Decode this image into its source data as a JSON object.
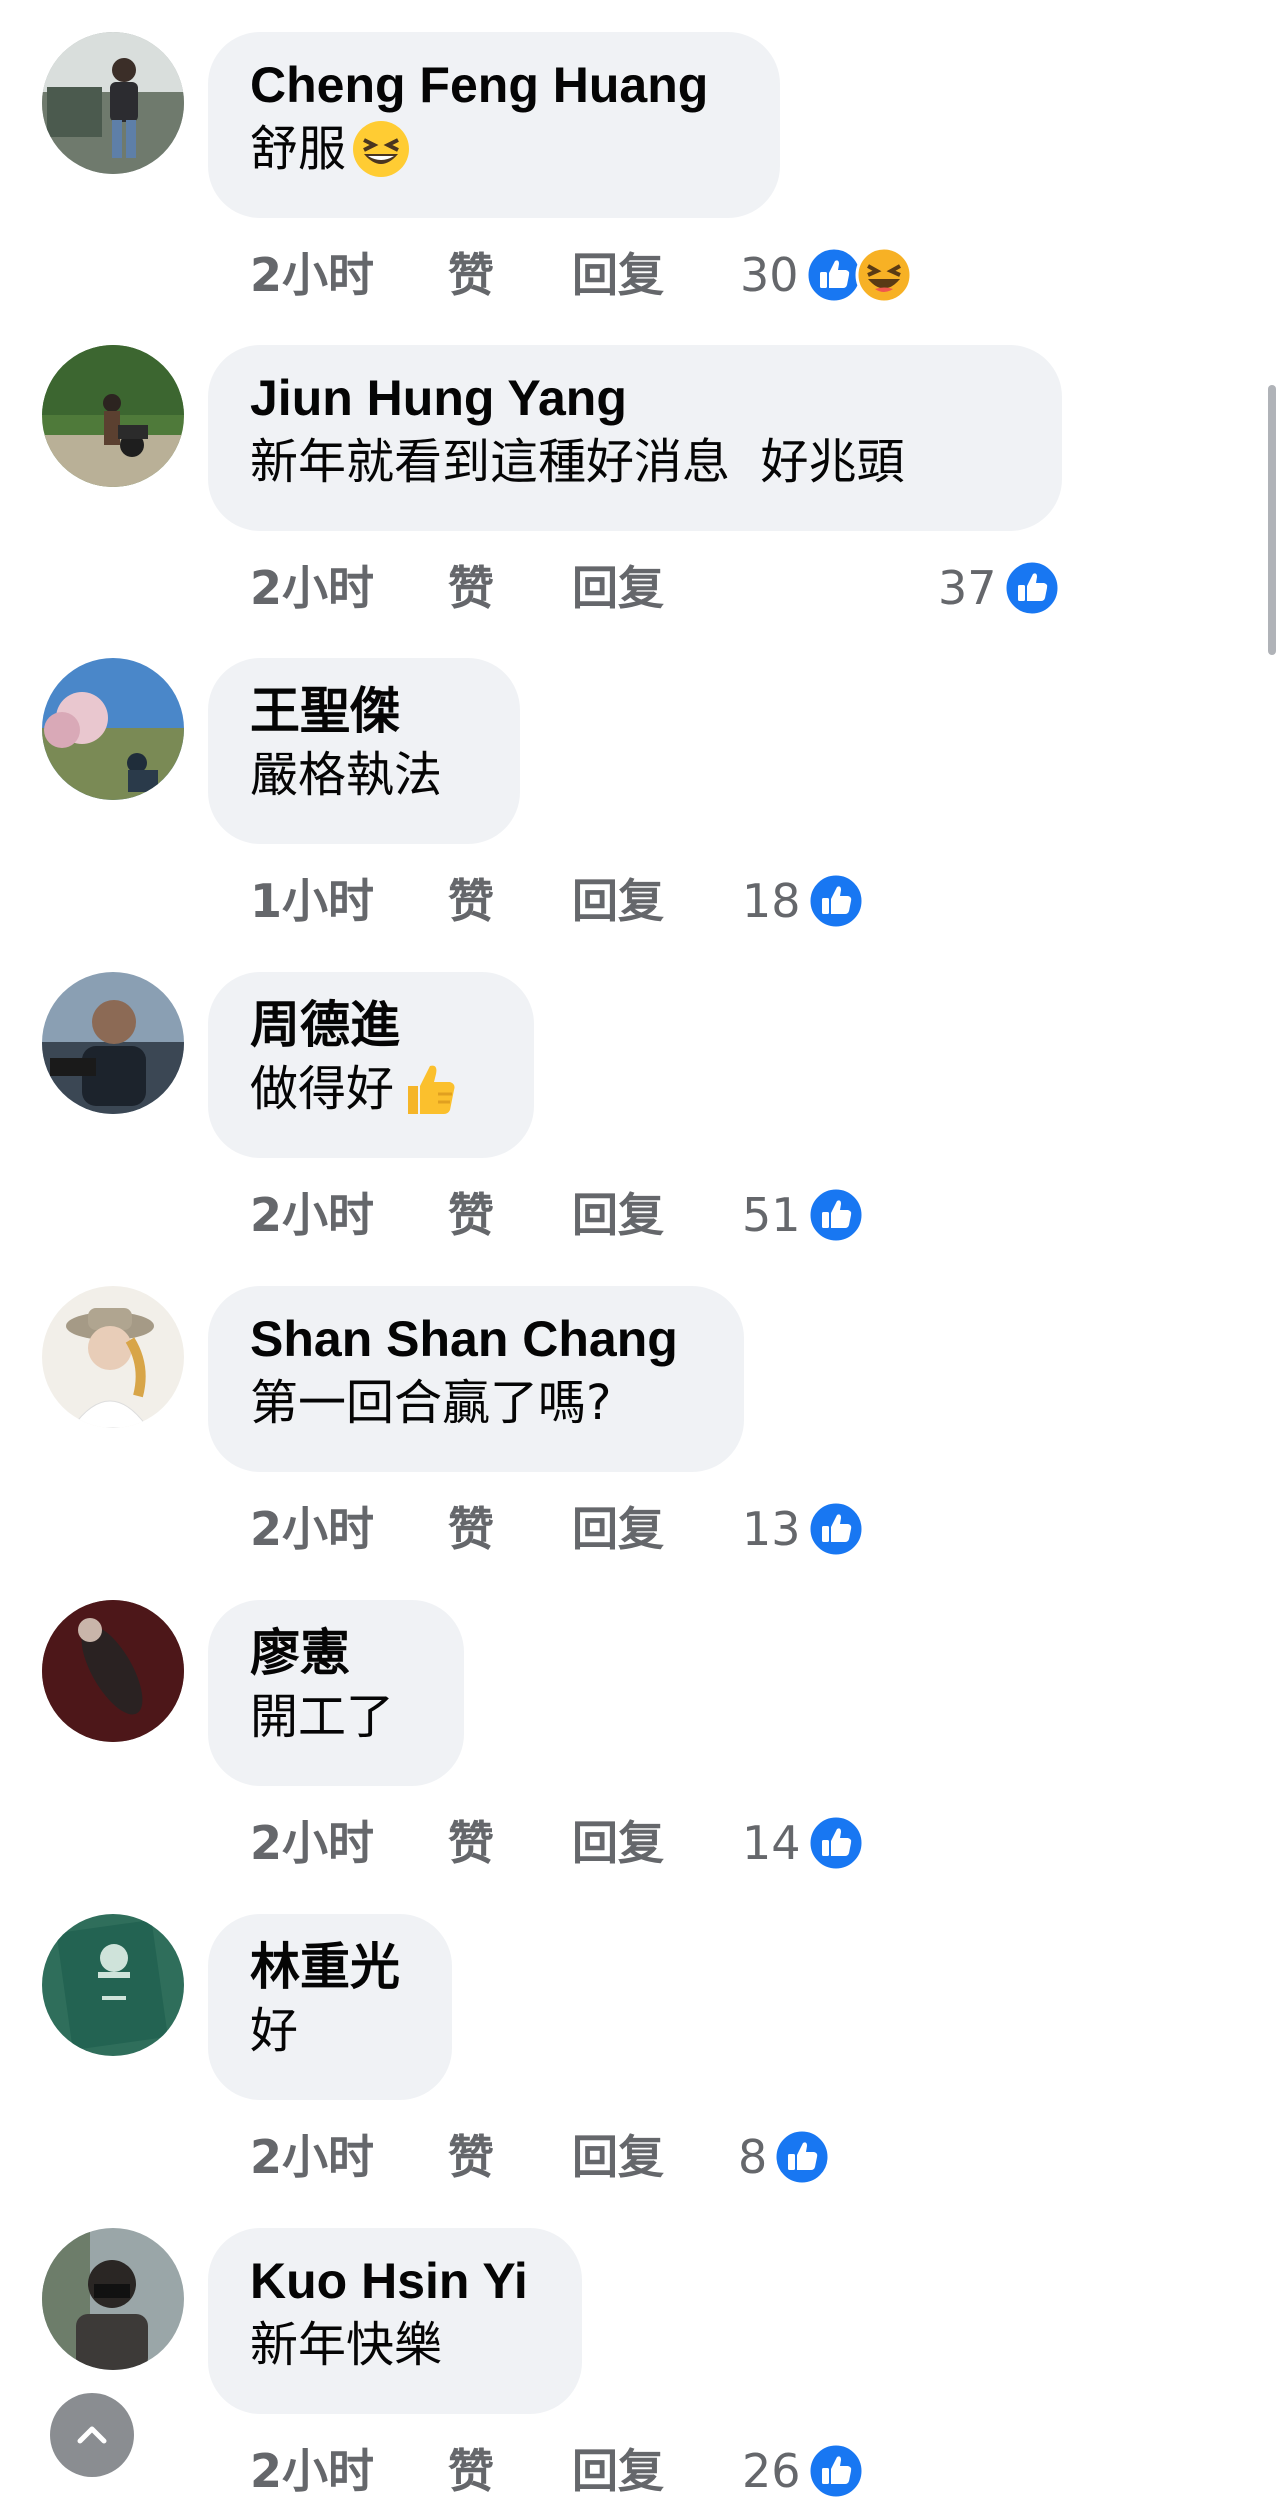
{
  "comments": [
    {
      "name": "Cheng Feng Huang",
      "text": "舒服",
      "emoji": "grinning-squinting-face",
      "time": "2小时",
      "like": "赞",
      "reply": "回复",
      "count": "30",
      "reactions": [
        "like",
        "haha"
      ]
    },
    {
      "name": "Jiun Hung Yang",
      "text": "新年就看到這種好消息  好兆頭",
      "emoji": "",
      "time": "2小时",
      "like": "赞",
      "reply": "回复",
      "count": "37",
      "reactions": [
        "like"
      ]
    },
    {
      "name": "王聖傑",
      "text": "嚴格執法",
      "emoji": "",
      "time": "1小时",
      "like": "赞",
      "reply": "回复",
      "count": "18",
      "reactions": [
        "like"
      ]
    },
    {
      "name": "周德進",
      "text": "做得好",
      "emoji": "thumbs-up",
      "time": "2小时",
      "like": "赞",
      "reply": "回复",
      "count": "51",
      "reactions": [
        "like"
      ]
    },
    {
      "name": "Shan Shan Chang",
      "text": "第一回合贏了嗎?",
      "emoji": "",
      "time": "2小时",
      "like": "赞",
      "reply": "回复",
      "count": "13",
      "reactions": [
        "like"
      ]
    },
    {
      "name": "廖憲",
      "text": "開工了",
      "emoji": "",
      "time": "2小时",
      "like": "赞",
      "reply": "回复",
      "count": "14",
      "reactions": [
        "like"
      ]
    },
    {
      "name": "林重光",
      "text": "好",
      "emoji": "",
      "time": "2小时",
      "like": "赞",
      "reply": "回复",
      "count": "8",
      "reactions": [
        "like"
      ]
    },
    {
      "name": "Kuo Hsin Yi",
      "text": "新年快樂",
      "emoji": "",
      "time": "2小时",
      "like": "赞",
      "reply": "回复",
      "count": "26",
      "reactions": [
        "like"
      ]
    }
  ],
  "colors": {
    "like_blue": "#1877f2",
    "haha_yellow": "#f7b125",
    "bubble": "#f0f2f5",
    "meta_gray": "#65676b"
  },
  "icons": {
    "scroll_top": "chevron-up-icon",
    "like": "like-reaction-icon",
    "haha": "haha-reaction-icon"
  }
}
